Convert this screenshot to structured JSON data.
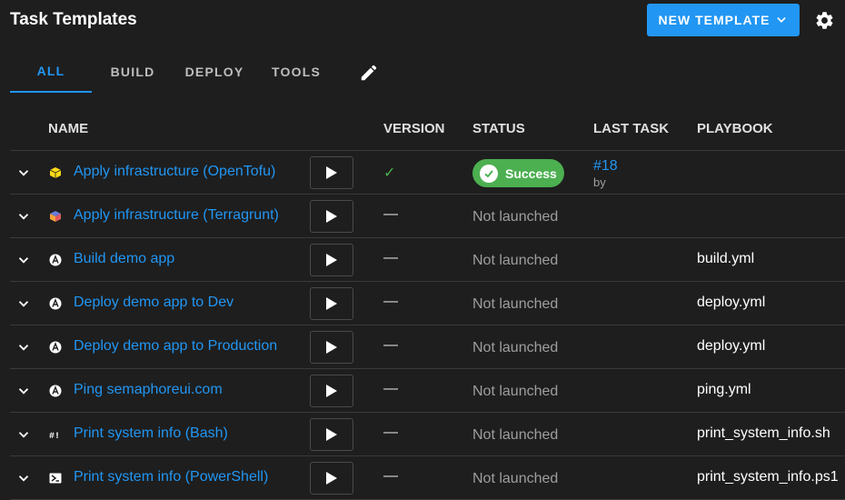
{
  "header": {
    "title": "Task Templates",
    "new_button_label": "NEW TEMPLATE"
  },
  "tabs": [
    {
      "label": "ALL",
      "active": true
    },
    {
      "label": "BUILD",
      "active": false
    },
    {
      "label": "DEPLOY",
      "active": false
    },
    {
      "label": "TOOLS",
      "active": false
    }
  ],
  "table": {
    "columns": [
      "NAME",
      "VERSION",
      "STATUS",
      "LAST TASK",
      "PLAYBOOK"
    ],
    "rows": [
      {
        "icon": "opentofu-icon",
        "name": "Apply infrastructure (OpenTofu)",
        "version": "✓",
        "status": "Success",
        "last_task": "#18",
        "last_by": "by",
        "playbook": ""
      },
      {
        "icon": "terragrunt-icon",
        "name": "Apply infrastructure (Terragrunt)",
        "version": "—",
        "status": "Not launched",
        "last_task": "",
        "last_by": "",
        "playbook": ""
      },
      {
        "icon": "ansible-icon",
        "name": "Build demo app",
        "version": "—",
        "status": "Not launched",
        "last_task": "",
        "last_by": "",
        "playbook": "build.yml"
      },
      {
        "icon": "ansible-icon",
        "name": "Deploy demo app to Dev",
        "version": "—",
        "status": "Not launched",
        "last_task": "",
        "last_by": "",
        "playbook": "deploy.yml"
      },
      {
        "icon": "ansible-icon",
        "name": "Deploy demo app to Production",
        "version": "—",
        "status": "Not launched",
        "last_task": "",
        "last_by": "",
        "playbook": "deploy.yml"
      },
      {
        "icon": "ansible-icon",
        "name": "Ping semaphoreui.com",
        "version": "—",
        "status": "Not launched",
        "last_task": "",
        "last_by": "",
        "playbook": "ping.yml"
      },
      {
        "icon": "bash-icon",
        "name": "Print system info (Bash)",
        "version": "—",
        "status": "Not launched",
        "last_task": "",
        "last_by": "",
        "playbook": "print_system_info.sh"
      },
      {
        "icon": "powershell-icon",
        "name": "Print system info (PowerShell)",
        "version": "—",
        "status": "Not launched",
        "last_task": "",
        "last_by": "",
        "playbook": "print_system_info.ps1"
      }
    ]
  },
  "colors": {
    "accent": "#2196f3",
    "success": "#4caf50",
    "background": "#1e1e1e"
  }
}
